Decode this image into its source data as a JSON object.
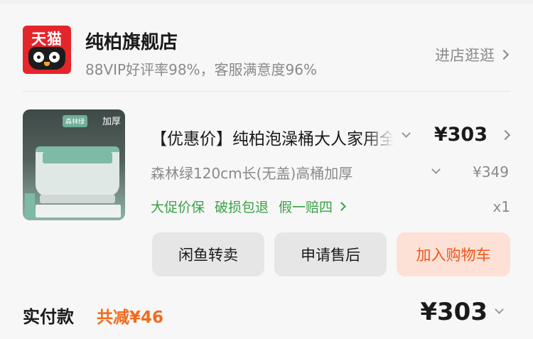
{
  "store": {
    "logo_text": "天猫",
    "name": "纯柏旗舰店",
    "rating": "88VIP好评率98%，客服满意度96%",
    "visit_label": "进店逛逛"
  },
  "product": {
    "image_tags": {
      "thick": "加厚",
      "color": "森林绿"
    },
    "title": "【优惠价】纯柏泡澡桶大人家用全身可折叠浴桶",
    "price": "¥303",
    "spec": "森林绿120cm长(无盖)高桶加厚",
    "original_price": "¥349",
    "services": [
      "大促价保",
      "破损包退",
      "假一赔四"
    ],
    "quantity": "x1"
  },
  "actions": {
    "resell": "闲鱼转卖",
    "after_sale": "申请售后",
    "add_cart": "加入购物车"
  },
  "summary": {
    "paid_label": "实付款",
    "discount": "共减¥46",
    "total": "¥303"
  },
  "colors": {
    "tmall_red": "#e4262b",
    "service_green": "#3aa145",
    "discount_orange": "#f26b1d",
    "cart_bg": "#fde1d6"
  }
}
